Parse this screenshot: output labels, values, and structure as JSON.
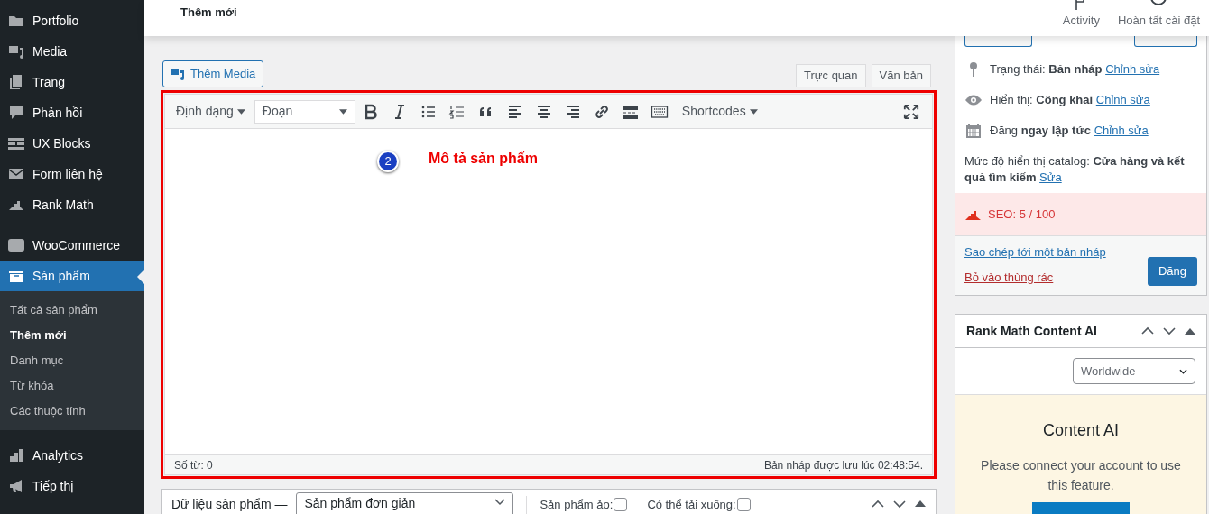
{
  "sidebar": {
    "items": [
      {
        "label": "Portfolio",
        "selected": false
      },
      {
        "label": "Media",
        "selected": false
      },
      {
        "label": "Trang",
        "selected": false
      },
      {
        "label": "Phản hồi",
        "selected": false
      },
      {
        "label": "UX Blocks",
        "selected": false
      },
      {
        "label": "Form liên hệ",
        "selected": false
      },
      {
        "label": "Rank Math",
        "selected": false
      },
      {
        "label": "WooCommerce",
        "selected": false
      },
      {
        "label": "Sản phẩm",
        "selected": true,
        "children": [
          {
            "label": "Tất cả sản phẩm",
            "selected": false
          },
          {
            "label": "Thêm mới",
            "selected": true
          },
          {
            "label": "Danh mục",
            "selected": false
          },
          {
            "label": "Từ khóa",
            "selected": false
          },
          {
            "label": "Các thuộc tính",
            "selected": false
          }
        ]
      },
      {
        "label": "Analytics",
        "selected": false
      },
      {
        "label": "Tiếp thị",
        "selected": false
      }
    ]
  },
  "header": {
    "title": "Thêm mới",
    "actions": [
      {
        "label": "Activity"
      },
      {
        "label": "Hoàn tất cài đặt"
      }
    ]
  },
  "editor": {
    "add_media": "Thêm Media",
    "tabs": [
      {
        "label": "Trực quan",
        "selected": false
      },
      {
        "label": "Văn bản",
        "selected": false
      }
    ],
    "format_menu": "Định dạng",
    "paragraph_select": "Đoạn",
    "shortcodes": "Shortcodes",
    "annotation": {
      "number": "2",
      "text": "Mô tả sản phẩm"
    },
    "word_count": "Số từ: 0",
    "saved_note": "Bản nháp được lưu lúc 02:48:54."
  },
  "product_data": {
    "title": "Dữ liệu sản phẩm —",
    "type_select": "Sản phẩm đơn giản",
    "checkboxes": [
      {
        "label": "Sản phẩm ảo:",
        "checked": false
      },
      {
        "label": "Có thể tải xuống:",
        "checked": false
      }
    ]
  },
  "publish": {
    "rows": [
      {
        "label": "Trạng thái:",
        "value": "Bản nháp",
        "link": "Chỉnh sửa"
      },
      {
        "label": "Hiển thị:",
        "value": "Công khai",
        "link": "Chỉnh sửa"
      },
      {
        "label": "Đăng",
        "value": "ngay lập tức",
        "link": "Chỉnh sửa"
      }
    ],
    "catalog": {
      "label": "Mức độ hiển thị catalog:",
      "value": "Cửa hàng và kết quả tìm kiếm",
      "link": "Sửa"
    },
    "seo": "SEO: 5 / 100",
    "copy_link": "Sao chép tới một bản nháp",
    "trash_link": "Bỏ vào thùng rác",
    "publish_button": "Đăng"
  },
  "content_ai": {
    "title": "Rank Math Content AI",
    "region_select": "Worldwide",
    "heading": "Content AI",
    "message": "Please connect your account to use this feature."
  }
}
